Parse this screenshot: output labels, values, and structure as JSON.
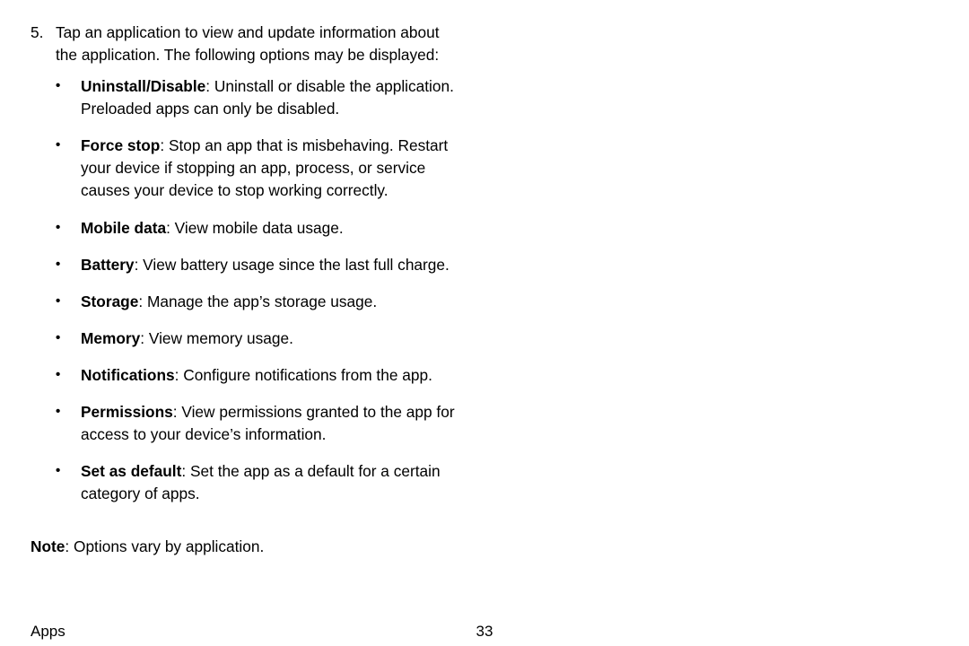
{
  "step": {
    "number": "5.",
    "intro": "Tap an application to view and update information about the application. The following options may be displayed:"
  },
  "options": [
    {
      "label": "Uninstall/Disable",
      "desc": ": Uninstall or disable the application. Preloaded apps can only be disabled."
    },
    {
      "label": "Force stop",
      "desc": ": Stop an app that is misbehaving. Restart your device if stopping an app, process, or service causes your device to stop working correctly."
    },
    {
      "label": "Mobile data",
      "desc": ": View mobile data usage."
    },
    {
      "label": "Battery",
      "desc": ": View battery usage since the last full charge."
    },
    {
      "label": "Storage",
      "desc": ": Manage the app’s storage usage."
    },
    {
      "label": "Memory",
      "desc": ": View memory usage."
    },
    {
      "label": "Notifications",
      "desc": ": Configure notifications from the app."
    },
    {
      "label": "Permissions",
      "desc": ": View permissions granted to the app for access to your device’s information."
    },
    {
      "label": "Set as default",
      "desc": ": Set the app as a default for a certain category of apps."
    }
  ],
  "note": {
    "label": "Note",
    "text": ": Options vary by application."
  },
  "footer": {
    "section": "Apps",
    "page": "33"
  },
  "bullet_glyph": "•"
}
